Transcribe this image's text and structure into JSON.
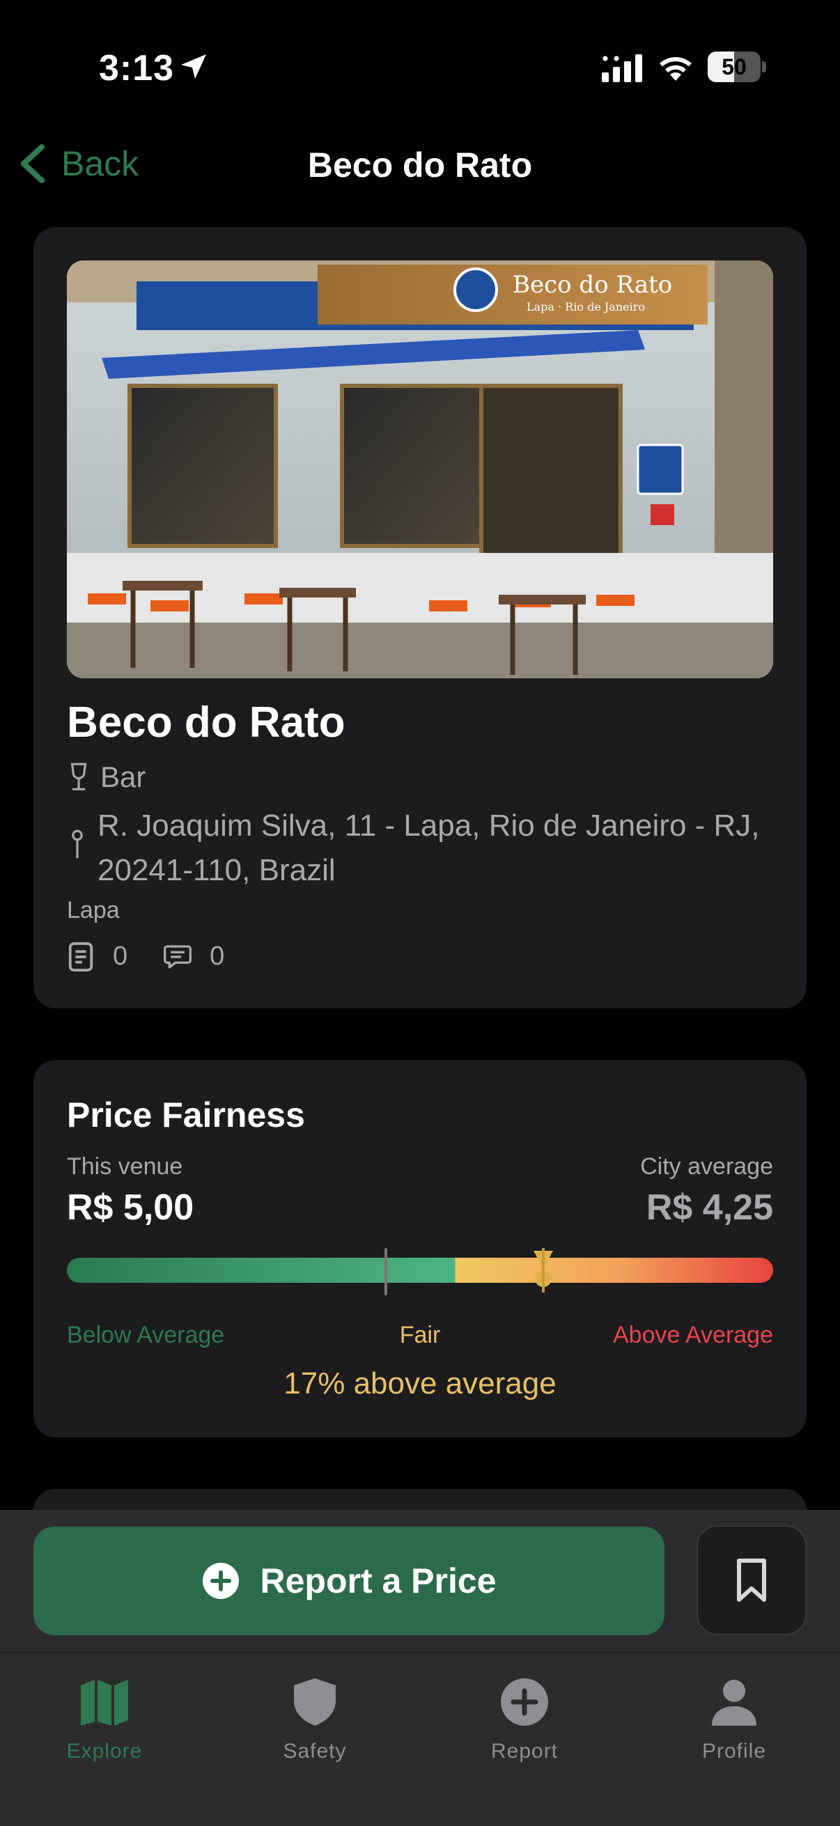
{
  "status_bar": {
    "time": "3:13",
    "battery": "50",
    "battery_level": 0.5
  },
  "nav": {
    "back_label": "Back",
    "title": "Beco do Rato"
  },
  "venue": {
    "photo_sign_title": "Beco do Rato",
    "photo_sign_subtitle": "Lapa · Rio de Janeiro",
    "name": "Beco do Rato",
    "type": "Bar",
    "address": "R. Joaquim Silva, 11 - Lapa, Rio de Janeiro - RJ, 20241-110, Brazil",
    "neighborhood": "Lapa",
    "reports_count": "0",
    "comments_count": "0"
  },
  "price_fairness": {
    "title": "Price Fairness",
    "this_venue_label": "This venue",
    "this_venue_value": "R$ 5,00",
    "city_average_label": "City average",
    "city_average_value": "R$ 4,25",
    "below_label": "Below Average",
    "fair_label": "Fair",
    "above_label": "Above Average",
    "summary": "17% above average",
    "colors": {
      "green": "#4fb482",
      "yellow": "#e8c067",
      "red": "#e8444f"
    }
  },
  "actions": {
    "report_label": "Report a Price"
  },
  "tabs": [
    {
      "label": "Explore",
      "icon": "map-icon",
      "active": true
    },
    {
      "label": "Safety",
      "icon": "shield-icon",
      "active": false
    },
    {
      "label": "Report",
      "icon": "plus-circle-icon",
      "active": false
    },
    {
      "label": "Profile",
      "icon": "person-icon",
      "active": false
    }
  ],
  "colors": {
    "accent": "#2f7a52",
    "button": "#2c6b4c",
    "card": "#1c1c1e",
    "background": "#000000"
  }
}
